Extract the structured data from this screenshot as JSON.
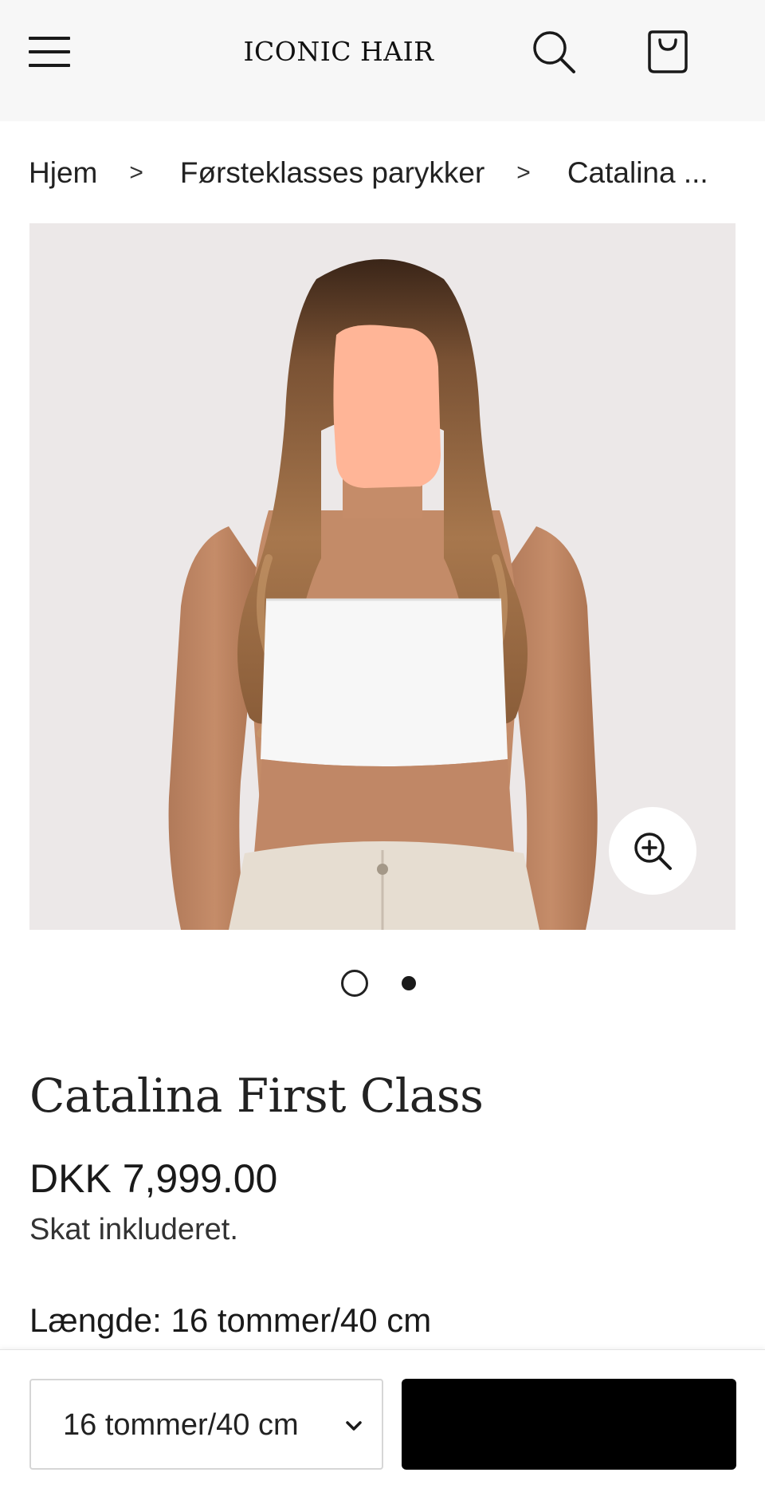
{
  "header": {
    "logo": "ICONIC HAIR",
    "menu_icon": "hamburger-menu-icon",
    "search_icon": "search-icon",
    "cart_icon": "shopping-bag-icon"
  },
  "breadcrumb": {
    "items": [
      "Hjem",
      "Førsteklasses parykker",
      "Catalina ..."
    ],
    "separator": ">"
  },
  "gallery": {
    "zoom_icon": "zoom-in-icon",
    "slide_count": 2
  },
  "product": {
    "title": "Catalina First Class",
    "price": "DKK 7,999.00",
    "tax_note": "Skat inkluderet.",
    "length_label": "Længde: 16 tommer/40 cm"
  },
  "purchase_bar": {
    "selected_length": "16 tommer/40 cm",
    "add_button_label": ""
  },
  "colors": {
    "header_bg": "#f7f7f7",
    "image_bg": "#ece8e8",
    "button_bg": "#000000"
  }
}
